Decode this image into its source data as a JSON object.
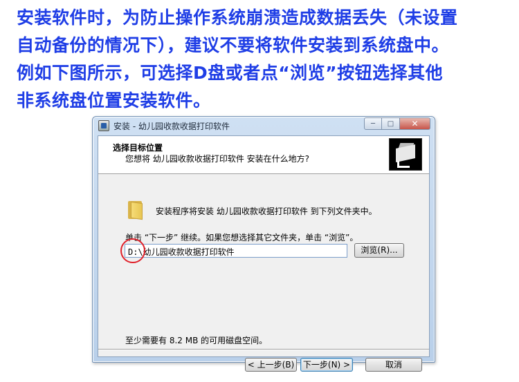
{
  "instructions": {
    "line1": "安装软件时，为防止操作系统崩溃造成数据丢失（未设置",
    "line2": "自动备份的情况下），建议不要将软件安装到系统盘中。",
    "line3": "例如下图所示，可选择D盘或者点“浏览”按钮选择其他",
    "line4": "非系统盘位置安装软件。",
    "color": "#1f3ee6"
  },
  "window": {
    "title": "安装 - 幼儿园收款收据打印软件",
    "minimize_label": "─",
    "maximize_label": "□",
    "close_label": "✕"
  },
  "header": {
    "title": "选择目标位置",
    "subtitle": "您想将 幼儿园收款收据打印软件 安装在什么地方?"
  },
  "body": {
    "install_text": "安装程序将安装 幼儿园收款收据打印软件 到下列文件夹中。",
    "continue_text": "单击 “下一步” 继续。如果您想选择其它文件夹，单击 “浏览”。",
    "path_value": "D:\\幼儿园收款收据打印软件",
    "browse_label": "浏览(R)...",
    "space_text": "至少需要有 8.2 MB 的可用磁盘空间。"
  },
  "footer": {
    "back_label": "< 上一步(B)",
    "next_label": "下一步(N) >",
    "cancel_label": "取消"
  },
  "colors": {
    "highlight_circle": "#e0202a"
  }
}
